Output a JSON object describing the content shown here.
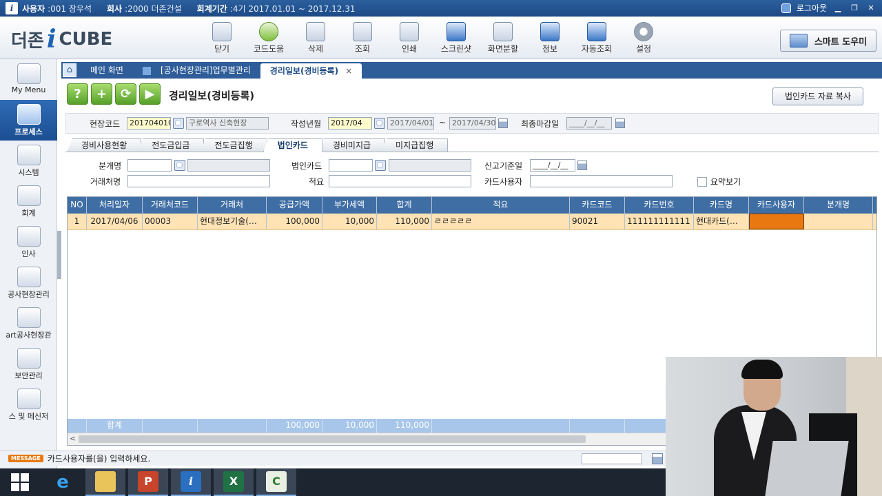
{
  "infobar": {
    "user_label": "사용자",
    "user_value": ":001 장우석",
    "company_label": "회사",
    "company_value": ":2000 더존건설",
    "period_label": "회계기간",
    "period_value": ":4기 2017.01.01 ~ 2017.12.31",
    "logout": "로그아웃"
  },
  "brand": {
    "left": "더존",
    "i": "i",
    "right": "CUBE"
  },
  "toolbar": [
    {
      "label": "닫기",
      "icon": "close-icon"
    },
    {
      "label": "코드도움",
      "icon": "code-help-icon"
    },
    {
      "label": "삭제",
      "icon": "delete-icon"
    },
    {
      "label": "조회",
      "icon": "search-icon"
    },
    {
      "label": "인쇄",
      "icon": "printer-icon"
    },
    {
      "label": "스크린샷",
      "icon": "screenshot-icon"
    },
    {
      "label": "화면분할",
      "icon": "split-screen-icon"
    },
    {
      "label": "정보",
      "icon": "info-icon"
    },
    {
      "label": "자동조회",
      "icon": "auto-search-icon"
    },
    {
      "label": "설정",
      "icon": "gear-icon"
    }
  ],
  "smart_button": "스마트 도우미",
  "leftnav": [
    {
      "label": "My Menu"
    },
    {
      "label": "프로세스"
    },
    {
      "label": "시스템"
    },
    {
      "label": "회계"
    },
    {
      "label": "인사"
    },
    {
      "label": "공사현장관리"
    },
    {
      "label": "art공사현장관"
    },
    {
      "label": "보안관리"
    },
    {
      "label": "스 및 메신저 "
    }
  ],
  "tabs": {
    "main": "메인 화면",
    "project": "[공사현장관리]업무별관리",
    "active": "경리일보(경비등록)",
    "close": "×"
  },
  "page": {
    "title": "경리일보(경비등록)",
    "copy_button": "법인카드 자료 복사"
  },
  "filter1": {
    "site_label": "현장코드",
    "site_code": "2017040101",
    "site_name": "구로역사 신축현장",
    "month_label": "작성년월",
    "month_value": "2017/04",
    "date_from": "2017/04/01",
    "tilde": "~",
    "date_to": "2017/04/30",
    "close_label": "최종마감일",
    "close_value": "____/__/__"
  },
  "subtabs": [
    "경비사용현황",
    "전도금입금",
    "전도금집행",
    "법인카드",
    "경비미지급",
    "미지급집행"
  ],
  "filter2": {
    "div_label": "분개명",
    "card_label": "법인카드",
    "report_label": "신고기준일",
    "report_value": "____/__/__",
    "partner_label": "거래처명",
    "memo_label": "적요",
    "card_user_label": "카드사용자",
    "summary_label": "요약보기"
  },
  "grid": {
    "headers": [
      "NO",
      "처리일자",
      "거래처코드",
      "거래처",
      "공급가액",
      "부가세액",
      "합계",
      "적요",
      "카드코드",
      "카드번호",
      "카드명",
      "카드사용자",
      "분개명"
    ],
    "rows": [
      {
        "no": "1",
        "date": "2017/04/06",
        "partner_code": "00003",
        "partner": "현대정보기술(…",
        "supply": "100,000",
        "vat": "10,000",
        "total": "110,000",
        "memo": "ㄹㄹㄹㄹㄹ",
        "card_code": "90021",
        "card_no": "111111111111",
        "card_name": "현대카드(…",
        "card_user": "",
        "division": ""
      }
    ],
    "footer": {
      "label": "합계",
      "supply": "100,000",
      "vat": "10,000",
      "total": "110,000"
    }
  },
  "status": {
    "badge": "MESSAGE",
    "message": "카드사용자를(을) 입력하세요."
  },
  "colors": {
    "header_blue": "#3f6ea5",
    "selected_row": "#ffe3b5",
    "active_cell": "#e8780f",
    "toolbar_blue": "#1d4a85"
  }
}
